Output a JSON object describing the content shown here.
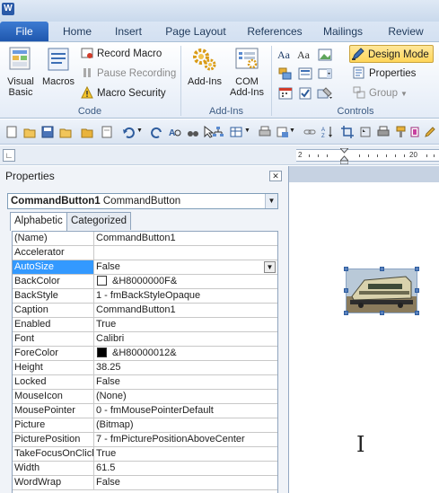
{
  "app": {
    "logo_letter": "W"
  },
  "tabs": [
    "File",
    "Home",
    "Insert",
    "Page Layout",
    "References",
    "Mailings",
    "Review"
  ],
  "ribbon": {
    "code": {
      "label": "Code",
      "visual_basic": "Visual\nBasic",
      "macros": "Macros",
      "record_macro": "Record Macro",
      "pause_recording": "Pause Recording",
      "macro_security": "Macro Security"
    },
    "addins": {
      "label": "Add-Ins",
      "addins_button": "Add-Ins",
      "com_addins": "COM\nAdd-Ins"
    },
    "controls": {
      "label": "Controls",
      "design_mode": "Design Mode",
      "properties": "Properties",
      "group": "Group"
    }
  },
  "ruler": {
    "numbers": [
      "2",
      "20"
    ]
  },
  "properties_pane": {
    "title": "Properties",
    "object_name": "CommandButton1",
    "object_type": "CommandButton",
    "tabs": [
      "Alphabetic",
      "Categorized"
    ],
    "rows": [
      {
        "name": "(Name)",
        "value": "CommandButton1"
      },
      {
        "name": "Accelerator",
        "value": ""
      },
      {
        "name": "AutoSize",
        "value": "False"
      },
      {
        "name": "BackColor",
        "value": "&H8000000F&"
      },
      {
        "name": "BackStyle",
        "value": "1 - fmBackStyleOpaque"
      },
      {
        "name": "Caption",
        "value": "CommandButton1"
      },
      {
        "name": "Enabled",
        "value": "True"
      },
      {
        "name": "Font",
        "value": "Calibri"
      },
      {
        "name": "ForeColor",
        "value": "&H80000012&"
      },
      {
        "name": "Height",
        "value": "38.25"
      },
      {
        "name": "Locked",
        "value": "False"
      },
      {
        "name": "MouseIcon",
        "value": "(None)"
      },
      {
        "name": "MousePointer",
        "value": "0 - fmMousePointerDefault"
      },
      {
        "name": "Picture",
        "value": "(Bitmap)"
      },
      {
        "name": "PicturePosition",
        "value": "7 - fmPicturePositionAboveCenter"
      },
      {
        "name": "TakeFocusOnClick",
        "value": "True"
      },
      {
        "name": "Width",
        "value": "61.5"
      },
      {
        "name": "WordWrap",
        "value": "False"
      }
    ],
    "selected_row": "AutoSize",
    "colors": {
      "backcolor_swatch": "#ffffff",
      "forecolor_swatch": "#000000",
      "selection": "#3399ff"
    }
  },
  "colors": {
    "file_tab": "#2b67c0",
    "design_mode_active": "#ffd65a"
  }
}
